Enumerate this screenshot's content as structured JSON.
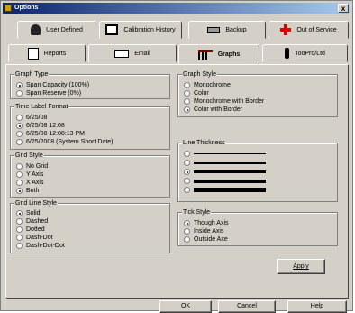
{
  "window": {
    "title": "Options",
    "close_glyph": "x"
  },
  "tabs_back": [
    {
      "label": "User Defined",
      "icon": "user-icon"
    },
    {
      "label": "Calibration History",
      "icon": "magnifier-icon"
    },
    {
      "label": "Backup",
      "icon": "drive-icon"
    },
    {
      "label": "Out of Service",
      "icon": "red-cross-icon"
    }
  ],
  "tabs_front": [
    {
      "label": "Reports",
      "icon": "reports-icon"
    },
    {
      "label": "Email",
      "icon": "email-icon"
    },
    {
      "label": "Graphs",
      "icon": "graph-icon",
      "active": true
    },
    {
      "label": "TooPro/Ltd",
      "icon": "probe-icon"
    }
  ],
  "graph_type": {
    "label": "Graph Type",
    "options": [
      "Span Capacity (100%)",
      "Span Reserve (0%)"
    ],
    "selected": 0
  },
  "time_label_format": {
    "label": "Time Label Format",
    "options": [
      "6/25/08",
      "6/25/08 12:08",
      "6/25/08 12:08:13 PM",
      "6/25/2008 (System Short Date)"
    ],
    "selected": 1
  },
  "grid_style": {
    "label": "Grid Style",
    "options": [
      "No Grid",
      "Y Axis",
      "X Axis",
      "Both"
    ],
    "selected": 3
  },
  "grid_line_style": {
    "label": "Grid Line Style",
    "options": [
      "Solid",
      "Dashed",
      "Dotted",
      "Dash-Dot",
      "Dash-Dot-Dot"
    ],
    "selected": 0
  },
  "graph_style": {
    "label": "Graph Style",
    "options": [
      "Monochrome",
      "Color",
      "Monochrome with Border",
      "Color with Border"
    ],
    "selected": 3
  },
  "line_thickness": {
    "label": "Line Thickness",
    "levels": [
      1,
      2,
      3,
      4,
      5
    ],
    "selected": 2
  },
  "tick_style": {
    "label": "Tick Style",
    "options": [
      "Though Axis",
      "Inside Axis",
      "Outside Axe"
    ],
    "selected": 0
  },
  "buttons": {
    "apply": "Apply",
    "ok": "OK",
    "cancel": "Cancel",
    "help": "Help"
  },
  "colors": {
    "title_start": "#0a246a",
    "title_end": "#a6caf0",
    "face": "#d4d0c8"
  }
}
